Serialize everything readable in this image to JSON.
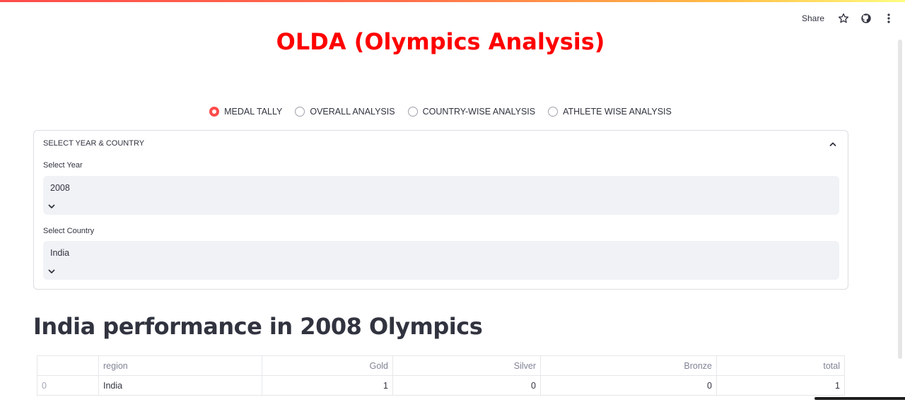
{
  "toolbar": {
    "share_label": "Share",
    "icons": [
      "star-icon",
      "github-icon",
      "kebab-menu-icon"
    ]
  },
  "app": {
    "title": "OLDA (Olympics Analysis)",
    "title_color": "#ff0000",
    "accent_color": "#ff4b4b"
  },
  "nav": {
    "options": [
      {
        "label": "MEDAL TALLY",
        "selected": true
      },
      {
        "label": "OVERALL ANALYSIS",
        "selected": false
      },
      {
        "label": "COUNTRY-WISE ANALYSIS",
        "selected": false
      },
      {
        "label": "ATHLETE WISE ANALYSIS",
        "selected": false
      }
    ]
  },
  "expander": {
    "title": "SELECT YEAR & COUNTRY",
    "year_label": "Select Year",
    "year_value": "2008",
    "country_label": "Select Country",
    "country_value": "India"
  },
  "result": {
    "heading": "India performance in 2008 Olympics",
    "columns": [
      "",
      "region",
      "Gold",
      "Silver",
      "Bronze",
      "total"
    ],
    "rows": [
      [
        "0",
        "India",
        "1",
        "0",
        "0",
        "1"
      ]
    ]
  }
}
